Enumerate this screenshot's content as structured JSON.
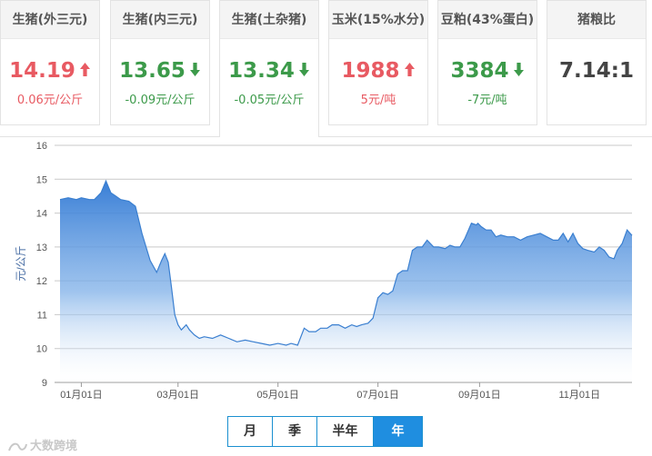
{
  "cards": [
    {
      "title": "生猪(外三元)",
      "value": "14.19",
      "trend": "up",
      "change": "0.06元/公斤"
    },
    {
      "title": "生猪(内三元)",
      "value": "13.65",
      "trend": "down",
      "change": "-0.09元/公斤"
    },
    {
      "title": "生猪(土杂猪)",
      "value": "13.34",
      "trend": "down",
      "change": "-0.05元/公斤"
    },
    {
      "title": "玉米(15%水分)",
      "value": "1988",
      "trend": "up",
      "change": "5元/吨"
    },
    {
      "title": "豆粕(43%蛋白)",
      "value": "3384",
      "trend": "down",
      "change": "-7元/吨"
    },
    {
      "title": "猪粮比",
      "value": "7.14:1",
      "trend": "none",
      "change": ""
    }
  ],
  "colors": {
    "up": "#e85a62",
    "down": "#3c9a4a",
    "line": "#3a7fd0",
    "accent": "#1f8ee0"
  },
  "chart_data": {
    "type": "area",
    "ylabel": "元/公斤",
    "ylim": [
      9,
      16
    ],
    "yticks": [
      "9",
      "10",
      "11",
      "12",
      "13",
      "14",
      "15",
      "16"
    ],
    "xticks": [
      {
        "label": "01月01日",
        "day": 0
      },
      {
        "label": "03月01日",
        "day": 59
      },
      {
        "label": "05月01日",
        "day": 120
      },
      {
        "label": "07月01日",
        "day": 181
      },
      {
        "label": "09月01日",
        "day": 243
      },
      {
        "label": "11月01日",
        "day": 304
      }
    ],
    "grid": true,
    "x_day": [
      -13,
      -8,
      -3,
      0,
      5,
      8,
      12,
      15,
      18,
      21,
      24,
      29,
      33,
      37,
      42,
      46,
      49,
      51,
      53,
      55,
      57,
      59,
      61,
      62,
      64,
      66,
      69,
      72,
      75,
      80,
      85,
      90,
      95,
      100,
      105,
      110,
      115,
      120,
      125,
      128,
      132,
      136,
      139,
      143,
      146,
      150,
      153,
      157,
      161,
      165,
      168,
      171,
      175,
      178,
      181,
      184,
      187,
      190,
      193,
      196,
      199,
      202,
      205,
      208,
      211,
      215,
      218,
      222,
      225,
      228,
      231,
      234,
      238,
      241,
      242,
      244,
      247,
      250,
      253,
      256,
      260,
      264,
      268,
      272,
      276,
      280,
      284,
      288,
      291,
      294,
      297,
      300,
      303,
      306,
      309,
      313,
      316,
      319,
      322,
      325,
      327,
      330,
      333,
      336
    ],
    "y": [
      14.4,
      14.45,
      14.4,
      14.45,
      14.4,
      14.4,
      14.6,
      14.95,
      14.6,
      14.5,
      14.4,
      14.35,
      14.2,
      13.4,
      12.6,
      12.25,
      12.6,
      12.8,
      12.55,
      11.8,
      11.0,
      10.7,
      10.55,
      10.6,
      10.7,
      10.55,
      10.4,
      10.3,
      10.35,
      10.3,
      10.4,
      10.3,
      10.2,
      10.25,
      10.2,
      10.15,
      10.1,
      10.15,
      10.1,
      10.15,
      10.1,
      10.6,
      10.5,
      10.5,
      10.6,
      10.6,
      10.7,
      10.7,
      10.6,
      10.7,
      10.65,
      10.7,
      10.75,
      10.9,
      11.5,
      11.65,
      11.6,
      11.7,
      12.2,
      12.3,
      12.3,
      12.9,
      13.0,
      13.0,
      13.2,
      13.0,
      13.0,
      12.95,
      13.05,
      13.0,
      13.0,
      13.25,
      13.7,
      13.65,
      13.7,
      13.6,
      13.5,
      13.5,
      13.3,
      13.35,
      13.3,
      13.3,
      13.2,
      13.3,
      13.35,
      13.4,
      13.3,
      13.2,
      13.2,
      13.4,
      13.15,
      13.4,
      13.1,
      12.95,
      12.9,
      12.85,
      13.0,
      12.9,
      12.7,
      12.65,
      12.9,
      13.1,
      13.5,
      13.34
    ]
  },
  "period_buttons": [
    {
      "label": "月",
      "active": false
    },
    {
      "label": "季",
      "active": false
    },
    {
      "label": "半年",
      "active": false
    },
    {
      "label": "年",
      "active": true
    }
  ],
  "watermark": "大数跨境"
}
